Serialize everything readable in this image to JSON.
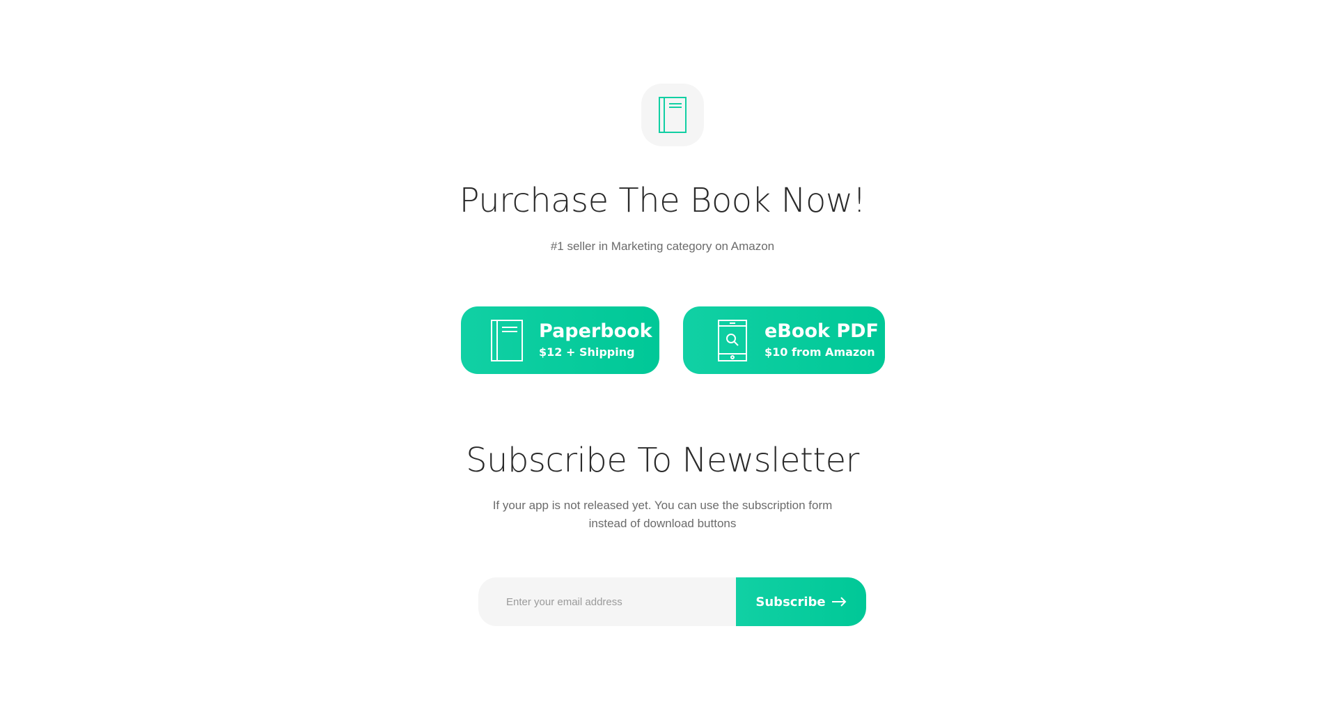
{
  "purchase": {
    "icon": "book-icon",
    "title": "Purchase The Book Now!",
    "subtitle": "#1 seller in Marketing category on Amazon",
    "options": [
      {
        "icon": "book-icon",
        "name": "Paperbook",
        "price": "$12 + Shipping"
      },
      {
        "icon": "tablet-search-icon",
        "name": "eBook PDF",
        "price": "$10 from Amazon"
      }
    ]
  },
  "newsletter": {
    "title": "Subscribe To Newsletter",
    "description_line1": "If your app is not released yet. You can use the subscription form",
    "description_line2": "instead of download buttons",
    "email_placeholder": "Enter your email address",
    "email_value": "",
    "button_label": "Subscribe",
    "button_icon": "arrow-right-icon"
  },
  "colors": {
    "accent": "#00C897",
    "badge_bg": "#F5F5F5",
    "text_dark": "#2A2A2A",
    "text_muted": "#6B6B6B"
  }
}
